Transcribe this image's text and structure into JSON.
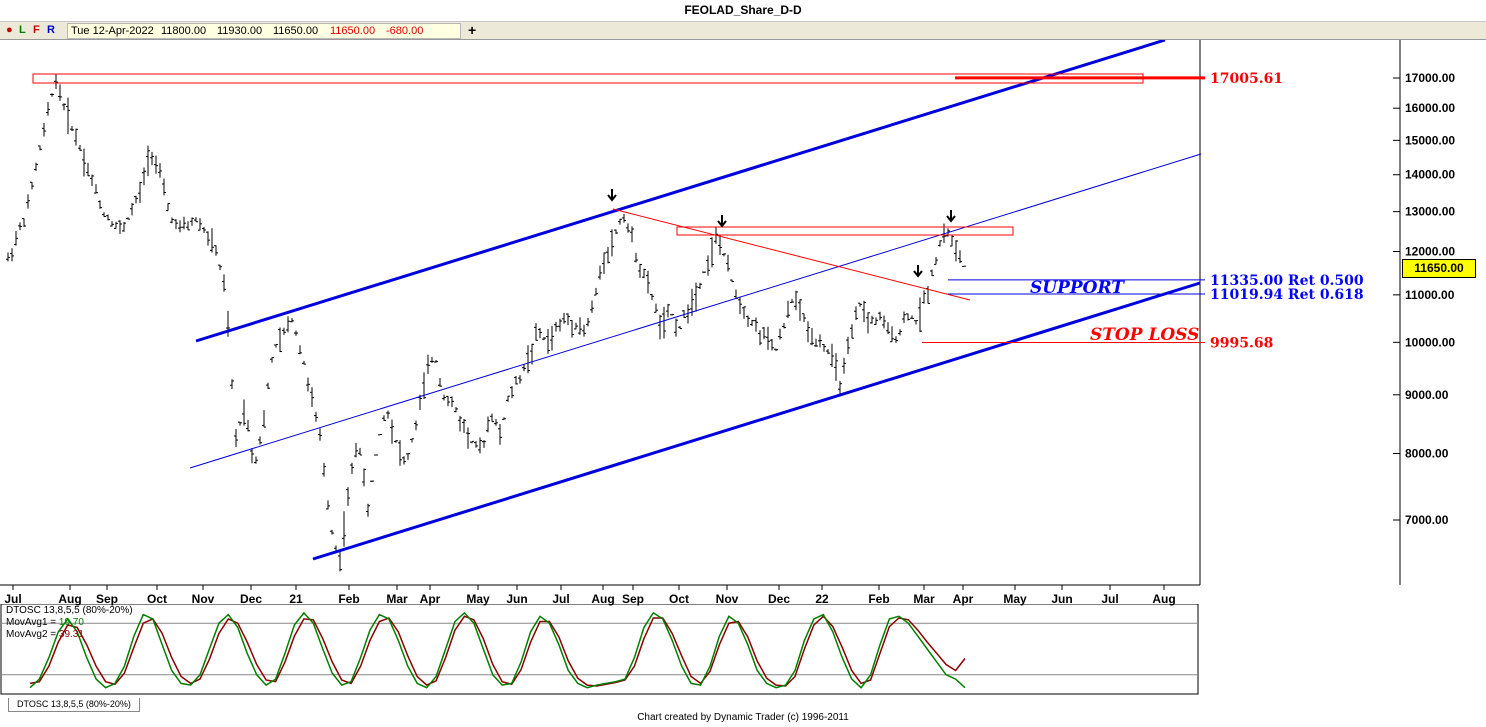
{
  "title": "FEOLAD_Share_D-D",
  "toolbar": {
    "icons": [
      "dot-icon",
      "L",
      "F",
      "R"
    ],
    "date": "Tue 12-Apr-2022",
    "open": "11800.00",
    "high": "11930.00",
    "low": "11650.00",
    "close": "11650.00",
    "change": "-680.00",
    "plus": "+"
  },
  "chart_data": {
    "type": "ohlc",
    "title": "FEOLAD_Share_D-D",
    "x_ticks": [
      "Jul",
      "Aug",
      "Sep",
      "Oct",
      "Nov",
      "Dec",
      "21",
      "Feb",
      "Mar",
      "Apr",
      "May",
      "Jun",
      "Jul",
      "Aug",
      "Sep",
      "Oct",
      "Nov",
      "Dec",
      "22",
      "Feb",
      "Mar",
      "Apr",
      "May",
      "Jun",
      "Jul",
      "Aug"
    ],
    "y_ticks": [
      "17000.00",
      "16000.00",
      "15000.00",
      "14000.00",
      "13000.00",
      "12000.00",
      "11000.00",
      "10000.00",
      "9000.00",
      "8000.00",
      "7000.00"
    ],
    "y_scale": "log",
    "ylim": [
      6200,
      18200
    ],
    "last_price": "11650.00",
    "price_path": [
      [
        0,
        11800
      ],
      [
        2,
        13000
      ],
      [
        4,
        15500
      ],
      [
        5,
        17000
      ],
      [
        6,
        16000
      ],
      [
        8,
        14500
      ],
      [
        10,
        13000
      ],
      [
        12,
        12500
      ],
      [
        14,
        13500
      ],
      [
        15,
        14800
      ],
      [
        16,
        14000
      ],
      [
        17,
        13000
      ],
      [
        18,
        12500
      ],
      [
        20,
        12800
      ],
      [
        22,
        12000
      ],
      [
        23,
        11000
      ],
      [
        24,
        8200
      ],
      [
        25,
        8800
      ],
      [
        26,
        7800
      ],
      [
        27,
        8500
      ],
      [
        28,
        9800
      ],
      [
        29,
        10100
      ],
      [
        30,
        10500
      ],
      [
        31,
        9800
      ],
      [
        32,
        9000
      ],
      [
        33,
        8200
      ],
      [
        34,
        7000
      ],
      [
        35,
        6400
      ],
      [
        36,
        7400
      ],
      [
        37,
        8300
      ],
      [
        38,
        7100
      ],
      [
        39,
        8100
      ],
      [
        40,
        8800
      ],
      [
        41,
        8200
      ],
      [
        42,
        7800
      ],
      [
        43,
        8400
      ],
      [
        44,
        9200
      ],
      [
        45,
        9800
      ],
      [
        46,
        9000
      ],
      [
        47,
        8800
      ],
      [
        48,
        8500
      ],
      [
        49,
        8200
      ],
      [
        50,
        8000
      ],
      [
        51,
        8700
      ],
      [
        52,
        8300
      ],
      [
        53,
        9000
      ],
      [
        54,
        9300
      ],
      [
        55,
        9700
      ],
      [
        56,
        10200
      ],
      [
        57,
        10000
      ],
      [
        58,
        10300
      ],
      [
        59,
        10500
      ],
      [
        60,
        10400
      ],
      [
        61,
        10200
      ],
      [
        62,
        10900
      ],
      [
        63,
        11900
      ],
      [
        64,
        12300
      ],
      [
        65,
        13000
      ],
      [
        66,
        12200
      ],
      [
        67,
        11500
      ],
      [
        68,
        11000
      ],
      [
        69,
        10300
      ],
      [
        70,
        10600
      ],
      [
        71,
        10300
      ],
      [
        72,
        10800
      ],
      [
        73,
        11200
      ],
      [
        74,
        11800
      ],
      [
        75,
        12400
      ],
      [
        76,
        11600
      ],
      [
        77,
        11000
      ],
      [
        78,
        10600
      ],
      [
        79,
        10300
      ],
      [
        80,
        10100
      ],
      [
        81,
        9800
      ],
      [
        82,
        10300
      ],
      [
        83,
        11000
      ],
      [
        84,
        10500
      ],
      [
        85,
        10100
      ],
      [
        86,
        10000
      ],
      [
        87,
        9700
      ],
      [
        88,
        9200
      ],
      [
        89,
        10000
      ],
      [
        90,
        10800
      ],
      [
        91,
        10400
      ],
      [
        92,
        10500
      ],
      [
        93,
        10200
      ],
      [
        94,
        10100
      ],
      [
        95,
        10600
      ],
      [
        96,
        10400
      ],
      [
        97,
        11000
      ],
      [
        98,
        11800
      ],
      [
        99,
        12600
      ],
      [
        100,
        12100
      ],
      [
        101,
        11650
      ]
    ],
    "levels": [
      {
        "label": "17005.61",
        "value": 17005.61,
        "color": "#ff0000"
      },
      {
        "label": "11335.00 Ret 0.500",
        "value": 11335,
        "color": "#0000ff"
      },
      {
        "label": "11019.94 Ret 0.618",
        "value": 11019.94,
        "color": "#0000ff"
      },
      {
        "label": "9995.68",
        "value": 9995.68,
        "color": "#ff0000"
      }
    ],
    "annotations": [
      {
        "text": "SUPPORT",
        "color": "#0000ff"
      },
      {
        "text": "STOP LOSS",
        "color": "#ff0000"
      }
    ]
  },
  "oscillator": {
    "name": "DTOSC 13,8,5,5 (80%-20%)",
    "mov1_label": "MovAvg1 = ",
    "mov1_value": "19.70",
    "mov2_label": "MovAvg2 = ",
    "mov2_value": "39.31",
    "upper": 80,
    "lower": 20,
    "series1": [
      5,
      15,
      40,
      70,
      85,
      70,
      40,
      15,
      5,
      10,
      30,
      65,
      90,
      85,
      55,
      25,
      10,
      8,
      20,
      50,
      80,
      90,
      75,
      45,
      20,
      8,
      15,
      45,
      78,
      92,
      80,
      50,
      22,
      8,
      12,
      40,
      72,
      90,
      85,
      60,
      30,
      10,
      5,
      18,
      50,
      82,
      92,
      80,
      50,
      20,
      8,
      10,
      35,
      70,
      88,
      80,
      55,
      25,
      10,
      5,
      8,
      10,
      12,
      15,
      40,
      75,
      92,
      85,
      60,
      30,
      10,
      8,
      30,
      65,
      88,
      80,
      55,
      25,
      10,
      5,
      8,
      25,
      60,
      85,
      90,
      70,
      40,
      15,
      5,
      20,
      55,
      85,
      88,
      80,
      65,
      50,
      35,
      20,
      15,
      5
    ],
    "series2": [
      10,
      12,
      30,
      58,
      78,
      75,
      55,
      30,
      12,
      9,
      22,
      52,
      80,
      85,
      68,
      40,
      18,
      10,
      15,
      38,
      68,
      85,
      80,
      58,
      32,
      14,
      12,
      35,
      65,
      85,
      84,
      62,
      35,
      14,
      10,
      30,
      60,
      82,
      86,
      70,
      42,
      18,
      8,
      13,
      40,
      72,
      88,
      84,
      62,
      32,
      12,
      9,
      26,
      58,
      82,
      82,
      64,
      36,
      16,
      8,
      7,
      9,
      11,
      14,
      30,
      62,
      86,
      86,
      68,
      42,
      18,
      10,
      24,
      55,
      80,
      82,
      64,
      36,
      16,
      8,
      7,
      18,
      50,
      78,
      88,
      76,
      52,
      25,
      10,
      14,
      45,
      76,
      86,
      84,
      72,
      58,
      45,
      32,
      25,
      39
    ]
  },
  "osc_tab": "DTOSC 13,8,5,5 (80%-20%)",
  "footer": "Chart created by Dynamic Trader  (c) 1996-2011",
  "colors": {
    "up_channel": "#0000dd",
    "resistance": "#ff0000",
    "osc1": "#008000",
    "osc2": "#8b0000",
    "price": "#000000"
  }
}
